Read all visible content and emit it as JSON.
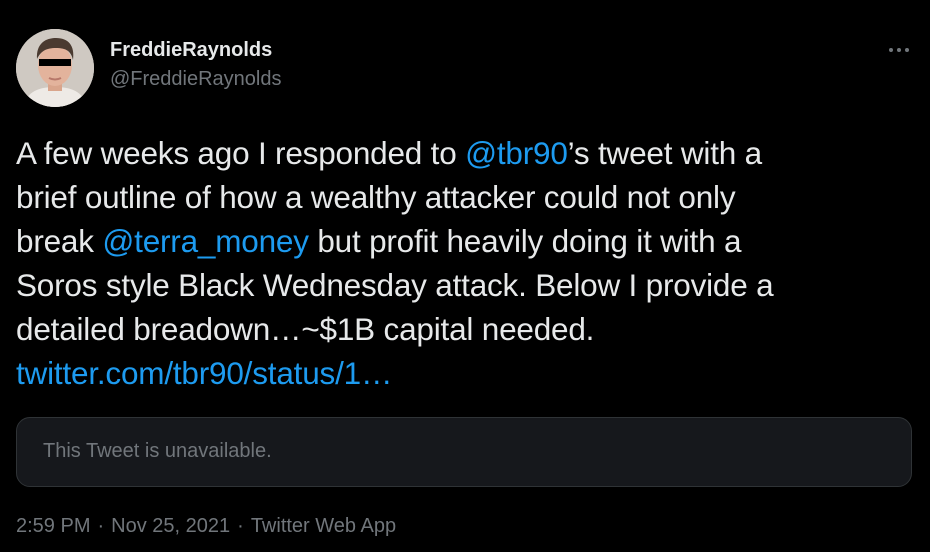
{
  "author": {
    "display_name": "FreddieRaynolds",
    "handle": "@FreddieRaynolds",
    "avatar_icon": "profile-photo"
  },
  "more_icon": "ellipsis-icon",
  "tweet": {
    "lines": [
      [
        {
          "text": "A few weeks ago I responded to ",
          "link": false
        },
        {
          "text": "@tbr90",
          "link": true
        },
        {
          "text": "’s tweet with a",
          "link": false
        }
      ],
      [
        {
          "text": "brief outline of how a wealthy attacker could not only",
          "link": false
        }
      ],
      [
        {
          "text": "break ",
          "link": false
        },
        {
          "text": "@terra_money",
          "link": true
        },
        {
          "text": " but profit heavily doing it with a",
          "link": false
        }
      ],
      [
        {
          "text": "Soros style Black Wednesday attack. Below I provide a",
          "link": false
        }
      ],
      [
        {
          "text": "detailed breadown…~$1B capital needed.",
          "link": false
        }
      ],
      [
        {
          "text": "twitter.com/tbr90/status/1…",
          "link": true
        }
      ]
    ]
  },
  "quote": {
    "text": "This Tweet is unavailable."
  },
  "meta": {
    "time": "2:59 PM",
    "separator": "·",
    "date": "Nov 25, 2021",
    "source": "Twitter Web App"
  },
  "colors": {
    "background": "#000000",
    "text": "#e7e9ea",
    "secondary": "#71767b",
    "link": "#1d9bf0",
    "card_bg": "#16181c",
    "card_border": "#2f3336"
  }
}
